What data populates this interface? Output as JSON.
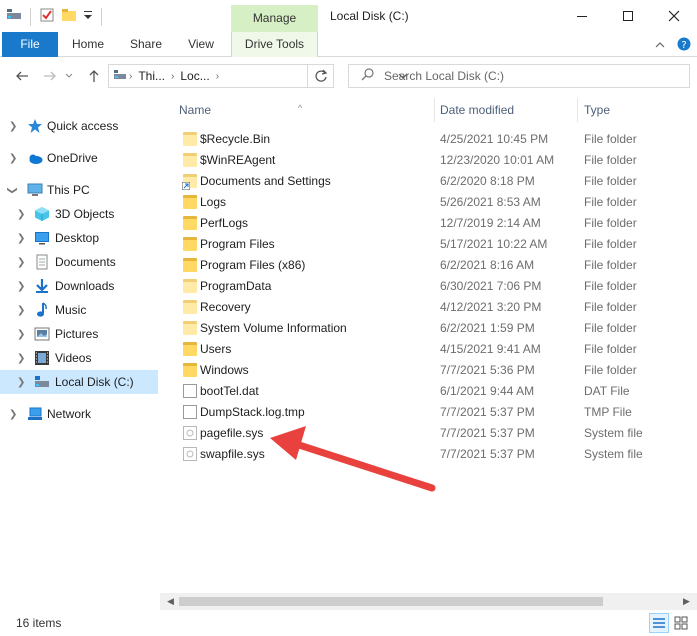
{
  "window": {
    "title": "Local Disk (C:)",
    "manage_tab": "Manage",
    "accent": "#1979ca",
    "manage_color": "#d7efc5"
  },
  "ribbon": {
    "tabs": [
      "File",
      "Home",
      "Share",
      "View",
      "Drive Tools"
    ]
  },
  "address": {
    "crumbs": [
      "Thi...",
      "Loc..."
    ],
    "search_placeholder": "Search Local Disk (C:)"
  },
  "nav": {
    "items": [
      {
        "label": "Quick access",
        "icon": "star-icon"
      },
      {
        "label": "OneDrive",
        "icon": "cloud-icon"
      },
      {
        "label": "This PC",
        "icon": "computer-icon"
      },
      {
        "label": "3D Objects",
        "icon": "cube-icon"
      },
      {
        "label": "Desktop",
        "icon": "desktop-icon"
      },
      {
        "label": "Documents",
        "icon": "document-icon"
      },
      {
        "label": "Downloads",
        "icon": "download-icon"
      },
      {
        "label": "Music",
        "icon": "music-icon"
      },
      {
        "label": "Pictures",
        "icon": "pictures-icon"
      },
      {
        "label": "Videos",
        "icon": "videos-icon"
      },
      {
        "label": "Local Disk (C:)",
        "icon": "drive-icon"
      },
      {
        "label": "Network",
        "icon": "network-icon"
      }
    ]
  },
  "columns": {
    "name": "Name",
    "date": "Date modified",
    "type": "Type"
  },
  "files": [
    {
      "name": "$Recycle.Bin",
      "date": "4/25/2021 10:45 PM",
      "type": "File folder",
      "icon": "folder-pale"
    },
    {
      "name": "$WinREAgent",
      "date": "12/23/2020 10:01 AM",
      "type": "File folder",
      "icon": "folder-pale"
    },
    {
      "name": "Documents and Settings",
      "date": "6/2/2020 8:18 PM",
      "type": "File folder",
      "icon": "shortcut"
    },
    {
      "name": "Logs",
      "date": "5/26/2021 8:53 AM",
      "type": "File folder",
      "icon": "folder"
    },
    {
      "name": "PerfLogs",
      "date": "12/7/2019 2:14 AM",
      "type": "File folder",
      "icon": "folder"
    },
    {
      "name": "Program Files",
      "date": "5/17/2021 10:22 AM",
      "type": "File folder",
      "icon": "folder"
    },
    {
      "name": "Program Files (x86)",
      "date": "6/2/2021 8:16 AM",
      "type": "File folder",
      "icon": "folder"
    },
    {
      "name": "ProgramData",
      "date": "6/30/2021 7:06 PM",
      "type": "File folder",
      "icon": "folder-pale"
    },
    {
      "name": "Recovery",
      "date": "4/12/2021 3:20 PM",
      "type": "File folder",
      "icon": "folder-pale"
    },
    {
      "name": "System Volume Information",
      "date": "6/2/2021 1:59 PM",
      "type": "File folder",
      "icon": "folder-pale"
    },
    {
      "name": "Users",
      "date": "4/15/2021 9:41 AM",
      "type": "File folder",
      "icon": "folder"
    },
    {
      "name": "Windows",
      "date": "7/7/2021 5:36 PM",
      "type": "File folder",
      "icon": "folder"
    },
    {
      "name": "bootTel.dat",
      "date": "6/1/2021 9:44 AM",
      "type": "DAT File",
      "icon": "file"
    },
    {
      "name": "DumpStack.log.tmp",
      "date": "7/7/2021 5:37 PM",
      "type": "TMP File",
      "icon": "file"
    },
    {
      "name": "pagefile.sys",
      "date": "7/7/2021 5:37 PM",
      "type": "System file",
      "icon": "sysfile"
    },
    {
      "name": "swapfile.sys",
      "date": "7/7/2021 5:37 PM",
      "type": "System file",
      "icon": "sysfile"
    }
  ],
  "status": {
    "count": "16 items"
  },
  "annotation": {
    "arrow_color": "#e8413e"
  }
}
